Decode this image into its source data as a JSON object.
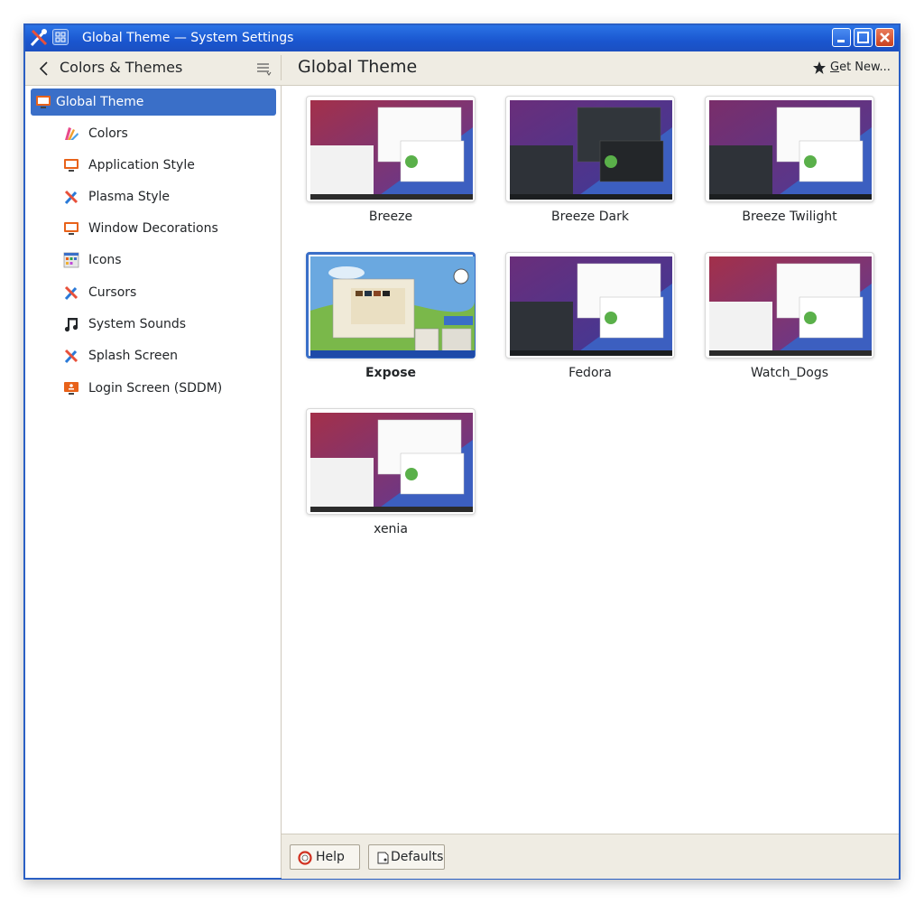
{
  "window": {
    "title": "Global Theme — System Settings"
  },
  "header": {
    "sidebar_title": "Colors & Themes",
    "page_title": "Global Theme",
    "get_new_label": "Get New..."
  },
  "sidebar": {
    "items": [
      {
        "label": "Global Theme",
        "icon": "monitor-icon",
        "selected": true
      },
      {
        "label": "Colors",
        "icon": "palette-icon"
      },
      {
        "label": "Application Style",
        "icon": "monitor-icon"
      },
      {
        "label": "Plasma Style",
        "icon": "brush-icon"
      },
      {
        "label": "Window Decorations",
        "icon": "monitor-icon"
      },
      {
        "label": "Icons",
        "icon": "icons-grid-icon"
      },
      {
        "label": "Cursors",
        "icon": "brush-icon"
      },
      {
        "label": "System Sounds",
        "icon": "music-note-icon"
      },
      {
        "label": "Splash Screen",
        "icon": "brush-icon"
      },
      {
        "label": "Login Screen (SDDM)",
        "icon": "login-monitor-icon"
      }
    ]
  },
  "themes": [
    {
      "name": "Breeze",
      "style": "light"
    },
    {
      "name": "Breeze Dark",
      "style": "dark"
    },
    {
      "name": "Breeze Twilight",
      "style": "twilight"
    },
    {
      "name": "Expose",
      "style": "expose",
      "selected": true
    },
    {
      "name": "Fedora",
      "style": "dark"
    },
    {
      "name": "Watch_Dogs",
      "style": "light"
    },
    {
      "name": "xenia",
      "style": "light"
    }
  ],
  "footer": {
    "help_label": "Help",
    "defaults_label": "Defaults"
  },
  "colors": {
    "accent": "#3a6fc8",
    "titlebar": "#1a56cf",
    "panel": "#efece3"
  }
}
